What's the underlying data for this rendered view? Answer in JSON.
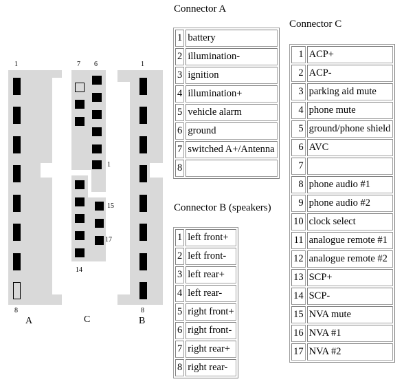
{
  "diagram": {
    "connectors": [
      {
        "id": "A",
        "label": "A",
        "top_pin_label": "1",
        "bottom_pin_label": "8"
      },
      {
        "id": "C",
        "label": "C",
        "pin_labels": {
          "top_left": "7",
          "top_right": "6",
          "mid_right": "1",
          "lower_right_top": "15",
          "lower_right_bottom": "17",
          "bottom_left": "14"
        }
      },
      {
        "id": "B",
        "label": "B",
        "top_pin_label": "1",
        "bottom_pin_label": "8"
      }
    ]
  },
  "tables": {
    "a": {
      "title": "Connector A",
      "rows": [
        {
          "num": "1",
          "name": "battery"
        },
        {
          "num": "2",
          "name": "illumination-"
        },
        {
          "num": "3",
          "name": "ignition"
        },
        {
          "num": "4",
          "name": "illumination+"
        },
        {
          "num": "5",
          "name": "vehicle alarm"
        },
        {
          "num": "6",
          "name": "ground"
        },
        {
          "num": "7",
          "name": "switched A+/Antenna"
        },
        {
          "num": "8",
          "name": ""
        }
      ]
    },
    "b": {
      "title": "Connector B (speakers)",
      "rows": [
        {
          "num": "1",
          "name": "left front+"
        },
        {
          "num": "2",
          "name": "left front-"
        },
        {
          "num": "3",
          "name": "left rear+"
        },
        {
          "num": "4",
          "name": "left rear-"
        },
        {
          "num": "5",
          "name": "right front+"
        },
        {
          "num": "6",
          "name": "right front-"
        },
        {
          "num": "7",
          "name": "right rear+"
        },
        {
          "num": "8",
          "name": "right rear-"
        }
      ]
    },
    "c": {
      "title": "Connector C",
      "rows": [
        {
          "num": "1",
          "name": "ACP+"
        },
        {
          "num": "2",
          "name": "ACP-"
        },
        {
          "num": "3",
          "name": "parking aid mute"
        },
        {
          "num": "4",
          "name": "phone mute"
        },
        {
          "num": "5",
          "name": "ground/phone shield"
        },
        {
          "num": "6",
          "name": "AVC"
        },
        {
          "num": "7",
          "name": ""
        },
        {
          "num": "8",
          "name": "phone audio #1"
        },
        {
          "num": "9",
          "name": "phone audio #2"
        },
        {
          "num": "10",
          "name": "clock select"
        },
        {
          "num": "11",
          "name": "analogue remote #1"
        },
        {
          "num": "12",
          "name": "analogue remote #2"
        },
        {
          "num": "13",
          "name": "SCP+"
        },
        {
          "num": "14",
          "name": "SCP-"
        },
        {
          "num": "15",
          "name": "NVA mute"
        },
        {
          "num": "16",
          "name": "NVA #1"
        },
        {
          "num": "17",
          "name": "NVA #2"
        }
      ]
    }
  }
}
